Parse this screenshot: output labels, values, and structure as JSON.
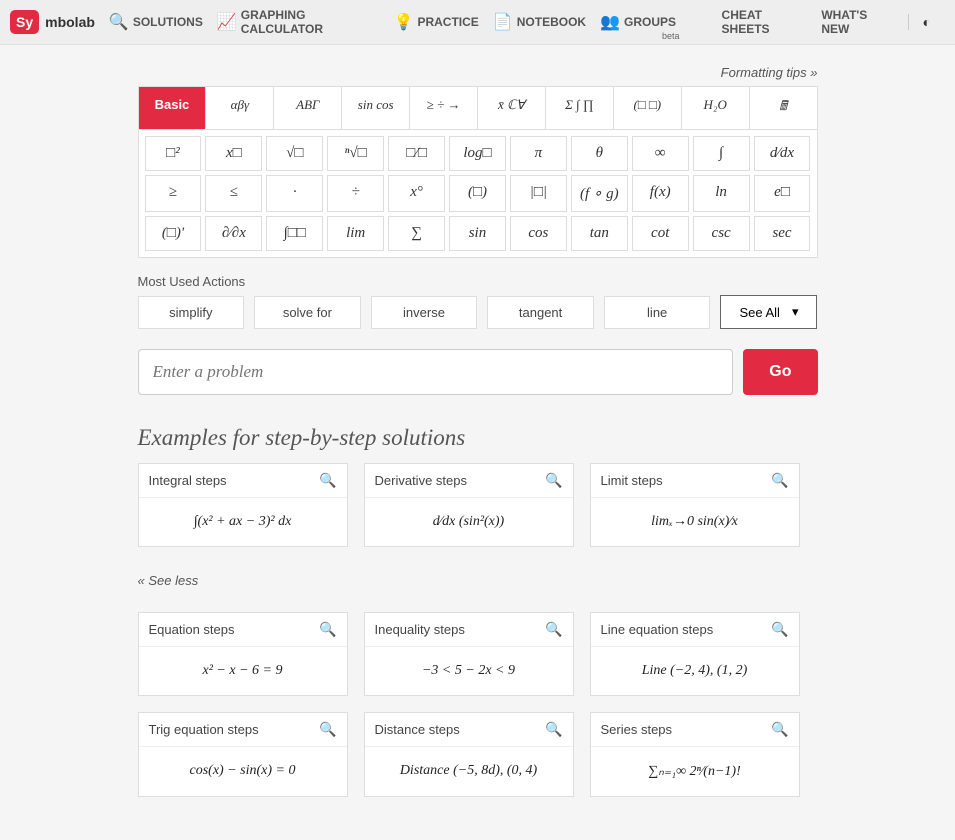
{
  "brand": {
    "logo_box": "Sy",
    "rest": "mbolab"
  },
  "nav": {
    "solutions": "SOLUTIONS",
    "graphing": "GRAPHING CALCULATOR",
    "practice": "PRACTICE",
    "notebook": "NOTEBOOK",
    "groups": "GROUPS",
    "groups_beta": "beta",
    "cheat": "CHEAT SHEETS",
    "whats_new": "WHAT'S NEW"
  },
  "fmt_tips": "Formatting tips »",
  "tabs": [
    "Basic",
    "αβγ",
    "ABΓ",
    "sin cos",
    "≥ ÷ →",
    "x̄ ℂ∀",
    "Σ ∫ ∏",
    "(□ □)",
    "H₂O",
    "🖩"
  ],
  "keypad": [
    [
      "□²",
      "x□",
      "√□",
      "ⁿ√□",
      "□⁄□",
      "log□",
      "π",
      "θ",
      "∞",
      "∫",
      "d⁄dx"
    ],
    [
      "≥",
      "≤",
      "·",
      "÷",
      "x°",
      "(□)",
      "|□|",
      "(f ∘ g)",
      "f(x)",
      "ln",
      "e□"
    ],
    [
      "(□)'",
      "∂⁄∂x",
      "∫□□",
      "lim",
      "∑",
      "sin",
      "cos",
      "tan",
      "cot",
      "csc",
      "sec"
    ]
  ],
  "actions_label": "Most Used Actions",
  "actions": [
    "simplify",
    "solve for",
    "inverse",
    "tangent",
    "line"
  ],
  "see_all": "See All",
  "input_placeholder": "Enter a problem",
  "go": "Go",
  "examples_title": "Examples for step-by-step solutions",
  "see_less": "« See less",
  "examples": [
    {
      "title": "Integral steps",
      "expr": "∫(x² + ax − 3)² dx"
    },
    {
      "title": "Derivative steps",
      "expr": "d⁄dx (sin²(x))"
    },
    {
      "title": "Limit steps",
      "expr": "limₓ→0 sin(x)⁄x"
    },
    {
      "title": "Equation steps",
      "expr": "x² − x − 6 = 9"
    },
    {
      "title": "Inequality steps",
      "expr": "−3 < 5 − 2x < 9"
    },
    {
      "title": "Line equation steps",
      "expr": "Line (−2, 4), (1, 2)"
    },
    {
      "title": "Trig equation steps",
      "expr": "cos(x) − sin(x) = 0"
    },
    {
      "title": "Distance steps",
      "expr": "Distance (−5, 8d), (0, 4)"
    },
    {
      "title": "Series steps",
      "expr": "∑ₙ₌₁∞ 2ⁿ⁄(n−1)!"
    }
  ]
}
